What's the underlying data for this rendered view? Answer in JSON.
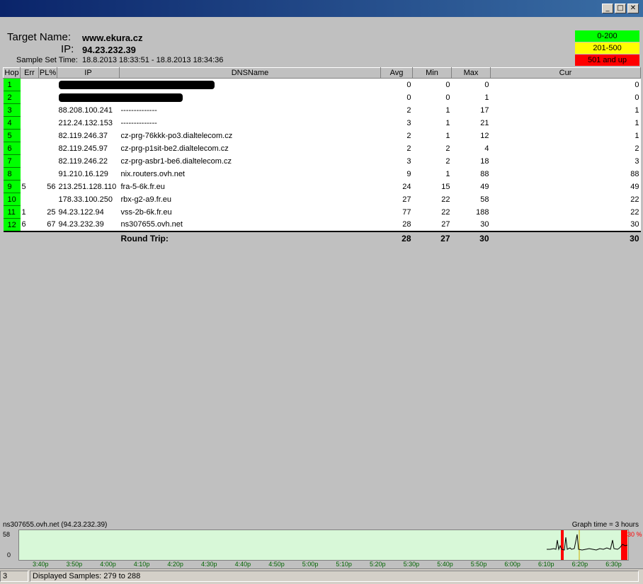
{
  "header": {
    "target_label": "Target Name:",
    "target_value": "www.ekura.cz",
    "ip_label": "IP:",
    "ip_value": "94.23.232.39",
    "sample_label": "Sample Set Time:",
    "sample_value": "18.8.2013 18:33:51 - 18.8.2013 18:34:36"
  },
  "legend": [
    {
      "label": "0-200",
      "color": "#00ff00",
      "text_color": "#000000"
    },
    {
      "label": "201-500",
      "color": "#ffff00",
      "text_color": "#000000"
    },
    {
      "label": "501 and up",
      "color": "#ff0000",
      "text_color": "#000000"
    }
  ],
  "columns": [
    "Hop",
    "Err",
    "PL%",
    "IP",
    "DNSName",
    "Avg",
    "Min",
    "Max",
    "Cur"
  ],
  "rows": [
    {
      "hop": "1",
      "err": "",
      "pl": "",
      "ip": "",
      "dns": "",
      "avg": "0",
      "min": "0",
      "max": "0",
      "cur": "0",
      "redacted": true
    },
    {
      "hop": "2",
      "err": "",
      "pl": "",
      "ip": "",
      "dns": "",
      "avg": "0",
      "min": "0",
      "max": "1",
      "cur": "0",
      "redacted": true
    },
    {
      "hop": "3",
      "err": "",
      "pl": "",
      "ip": "88.208.100.241",
      "dns": "--------------",
      "avg": "2",
      "min": "1",
      "max": "17",
      "cur": "1"
    },
    {
      "hop": "4",
      "err": "",
      "pl": "",
      "ip": "212.24.132.153",
      "dns": "--------------",
      "avg": "3",
      "min": "1",
      "max": "21",
      "cur": "1"
    },
    {
      "hop": "5",
      "err": "",
      "pl": "",
      "ip": "82.119.246.37",
      "dns": "cz-prg-76kkk-po3.dialtelecom.cz",
      "avg": "2",
      "min": "1",
      "max": "12",
      "cur": "1"
    },
    {
      "hop": "6",
      "err": "",
      "pl": "",
      "ip": "82.119.245.97",
      "dns": "cz-prg-p1sit-be2.dialtelecom.cz",
      "avg": "2",
      "min": "2",
      "max": "4",
      "cur": "2"
    },
    {
      "hop": "7",
      "err": "",
      "pl": "",
      "ip": "82.119.246.22",
      "dns": "cz-prg-asbr1-be6.dialtelecom.cz",
      "avg": "3",
      "min": "2",
      "max": "18",
      "cur": "3"
    },
    {
      "hop": "8",
      "err": "",
      "pl": "",
      "ip": "91.210.16.129",
      "dns": "nix.routers.ovh.net",
      "avg": "9",
      "min": "1",
      "max": "88",
      "cur": "88"
    },
    {
      "hop": "9",
      "err": "5",
      "pl": "56",
      "ip": "213.251.128.110",
      "dns": "fra-5-6k.fr.eu",
      "avg": "24",
      "min": "15",
      "max": "49",
      "cur": "49"
    },
    {
      "hop": "10",
      "err": "",
      "pl": "",
      "ip": "178.33.100.250",
      "dns": "rbx-g2-a9.fr.eu",
      "avg": "27",
      "min": "22",
      "max": "58",
      "cur": "22"
    },
    {
      "hop": "11",
      "err": "1",
      "pl": "25",
      "ip": "94.23.122.94",
      "dns": "vss-2b-6k.fr.eu",
      "avg": "77",
      "min": "22",
      "max": "188",
      "cur": "22"
    },
    {
      "hop": "12",
      "err": "6",
      "pl": "67",
      "ip": "94.23.232.39",
      "dns": "ns307655.ovh.net",
      "avg": "28",
      "min": "27",
      "max": "30",
      "cur": "30"
    }
  ],
  "round_trip": {
    "label": "Round Trip:",
    "avg": "28",
    "min": "27",
    "max": "30",
    "cur": "30"
  },
  "graph": {
    "host_label": "ns307655.ovh.net (94.23.232.39)",
    "graph_time": "Graph time = 3 hours",
    "y_max": "58",
    "y_min": "0",
    "loss_pct": "30 %",
    "x_ticks": [
      "3:40p",
      "3:50p",
      "4:00p",
      "4:10p",
      "4:20p",
      "4:30p",
      "4:40p",
      "4:50p",
      "5:00p",
      "5:10p",
      "5:20p",
      "5:30p",
      "5:40p",
      "5:50p",
      "6:00p",
      "6:10p",
      "6:20p",
      "6:30p"
    ]
  },
  "status": {
    "left": "3",
    "samples": "Displayed Samples: 279 to 288"
  },
  "window_buttons": {
    "minimize": "_",
    "maximize": "□",
    "close": "✕"
  }
}
